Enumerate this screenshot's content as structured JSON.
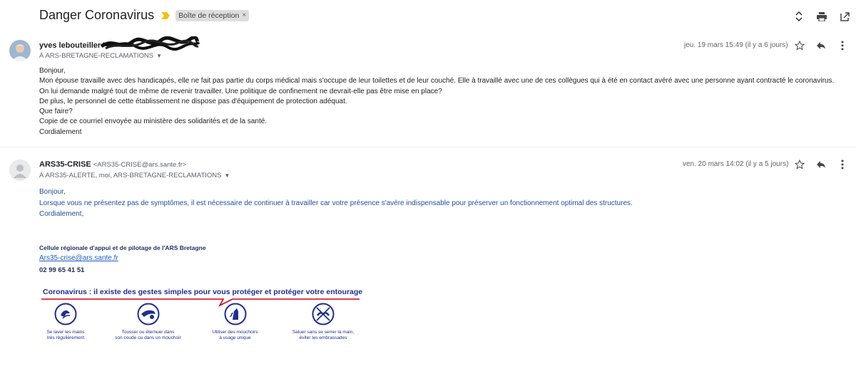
{
  "header": {
    "subject": "Danger Coronavirus",
    "label": "Boîte de réception",
    "label_close": "×"
  },
  "message1": {
    "sender": "yves lebouteiller",
    "recipients": "À ARS-BRETAGNE-RECLAMATIONS",
    "date": "jeu. 19 mars 15:49 (il y a 6 jours)",
    "lines": [
      "Bonjour,",
      "Mon épouse travaille avec des handicapés, elle ne fait pas partie du corps médical mais s'occupe de leur toilettes et de leur couché. Elle à travaillé avec une de ces collègues qui à été en contact avéré avec une personne ayant contracté le coronavirus.",
      "On lui demande malgré tout de même de revenir travailler. Une politique de confinement ne devrait-elle pas être mise en place?",
      "De plus, le personnel de cette établissement ne dispose pas d'équipement de protection adéquat.",
      "Que faire?",
      "Copie de ce courriel envoyée au ministère des solidarités et de la santé.",
      "Cordialement"
    ]
  },
  "message2": {
    "sender": "ARS35-CRISE",
    "sender_email": "<ARS35-CRISE@ars.sante.fr>",
    "recipients": "À ARS35-ALERTE, moi, ARS-BRETAGNE-RECLAMATIONS",
    "date": "ven. 20 mars 14:02 (il y a 5 jours)",
    "lines": [
      "Bonjour,",
      "Lorsque vous ne présentez pas de symptômes, il est nécessaire de continuer à travailler car votre présence s'avère indispensable pour préserver un fonctionnement optimal des structures.",
      "Cordialement,"
    ],
    "signature": {
      "title": "Cellule régionale d'appui et de pilotage de l'ARS Bretagne",
      "email": "Ars35-crise@ars.sante.fr",
      "phone": "02 99 65 41 51"
    },
    "banner": {
      "title": "Coronavirus : il existe des gestes simples pour vous protéger et protéger votre entourage",
      "gestures": [
        {
          "line1": "Se laver les mains",
          "line2": "très régulièrement"
        },
        {
          "line1": "Tousser ou éternuer dans",
          "line2": "son coude ou dans un mouchoir"
        },
        {
          "line1": "Utiliser des mouchoirs",
          "line2": "à usage unique"
        },
        {
          "line1": "Saluer sans se serrer la main,",
          "line2": "éviter les embrassades"
        }
      ]
    }
  },
  "colors": {
    "reply_text": "#1f4e9c",
    "banner_blue": "#1f2f8c",
    "banner_red": "#d0021b",
    "importance_yellow": "#f4c20d"
  }
}
